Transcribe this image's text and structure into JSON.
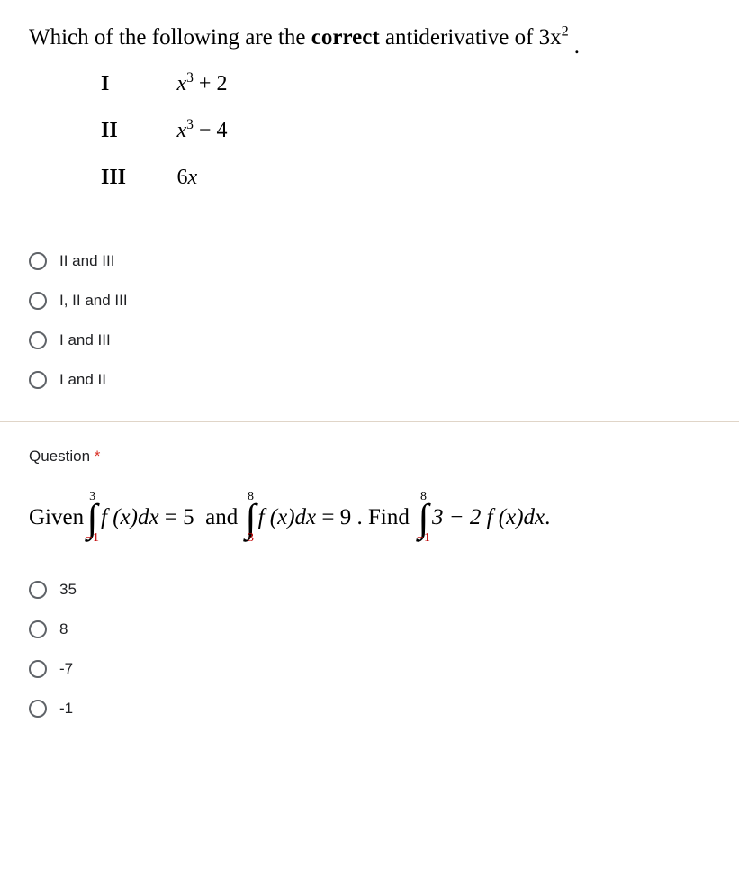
{
  "q1": {
    "stem_prefix": "Which  of the following are the ",
    "stem_bold": "correct",
    "stem_suffix": " antiderivative of ",
    "stem_math_base": "3x",
    "stem_math_exp": "2",
    "stem_dot": ".",
    "items": [
      {
        "num": "I",
        "base": "x",
        "exp": "3",
        "tail": " + 2"
      },
      {
        "num": "II",
        "base": "x",
        "exp": "3",
        "tail": " − 4"
      },
      {
        "num": "III",
        "base": "6",
        "exp": "",
        "tail": "x"
      }
    ],
    "options": [
      "II and III",
      "I, II and III",
      "I and III",
      "I and II"
    ]
  },
  "q2": {
    "header": "Question",
    "required": "*",
    "given": "Given ",
    "int1": {
      "lower": "−1",
      "upper": "3"
    },
    "fx1": "f (x)dx",
    "eq1": " = 5  and ",
    "int2": {
      "lower": "3",
      "upper": "8"
    },
    "fx2": "f (x)dx",
    "eq2": " = 9 . Find ",
    "int3": {
      "lower": "−1",
      "upper": "8"
    },
    "fx3": "3 − 2 f (x)dx",
    "dot": " .",
    "options": [
      "35",
      "8",
      "-7",
      "-1"
    ]
  }
}
